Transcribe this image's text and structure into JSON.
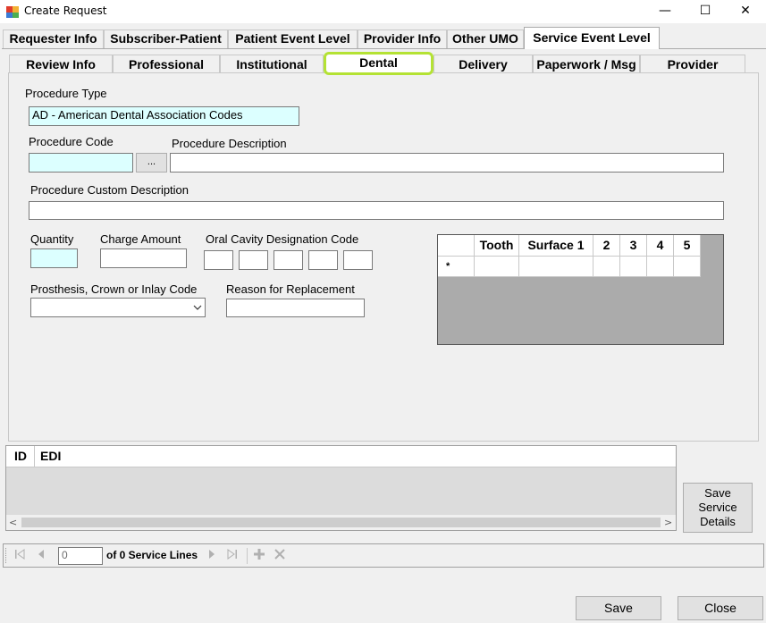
{
  "window": {
    "title": "Create Request",
    "minimize_glyph": "—",
    "maximize_glyph": "☐",
    "close_glyph": "✕"
  },
  "main_tabs": [
    {
      "label": "Requester Info"
    },
    {
      "label": "Subscriber-Patient"
    },
    {
      "label": "Patient Event Level"
    },
    {
      "label": "Provider Info"
    },
    {
      "label": "Other UMO"
    },
    {
      "label": "Service Event Level",
      "active": true
    }
  ],
  "sub_tabs": [
    {
      "label": "Review Info"
    },
    {
      "label": "Professional"
    },
    {
      "label": "Institutional"
    },
    {
      "label": "Dental",
      "active": true
    },
    {
      "label": "Delivery"
    },
    {
      "label": "Paperwork / Msg"
    },
    {
      "label": "Provider"
    }
  ],
  "form": {
    "procedure_type_label": "Procedure Type",
    "procedure_type_value": "AD - American Dental Association Codes",
    "procedure_code_label": "Procedure Code",
    "procedure_code_value": "",
    "lookup_button_label": "...",
    "procedure_description_label": "Procedure Description",
    "procedure_description_value": "",
    "custom_description_label": "Procedure Custom Description",
    "custom_description_value": "",
    "quantity_label": "Quantity",
    "quantity_value": "",
    "charge_amount_label": "Charge Amount",
    "charge_amount_value": "",
    "oral_cavity_label": "Oral Cavity Designation Code",
    "oral_cavity_values": [
      "",
      "",
      "",
      "",
      ""
    ],
    "prosthesis_label": "Prosthesis, Crown or Inlay Code",
    "prosthesis_value": "",
    "reason_label": "Reason for Replacement",
    "reason_value": ""
  },
  "tooth_grid": {
    "columns": [
      "",
      "Tooth",
      "Surface 1",
      "2",
      "3",
      "4",
      "5"
    ],
    "new_row_marker": "*"
  },
  "service_lines": {
    "columns": [
      "ID",
      "EDI"
    ],
    "scroll_left": "<",
    "scroll_right": ">"
  },
  "save_service_details_label": "Save Service Details",
  "navigator": {
    "position_value": "0",
    "count_text": "of 0 Service Lines"
  },
  "footer": {
    "save_label": "Save",
    "close_label": "Close"
  },
  "colors": {
    "required_field": "#dcffff",
    "active_tab_highlight": "#b4e234"
  }
}
